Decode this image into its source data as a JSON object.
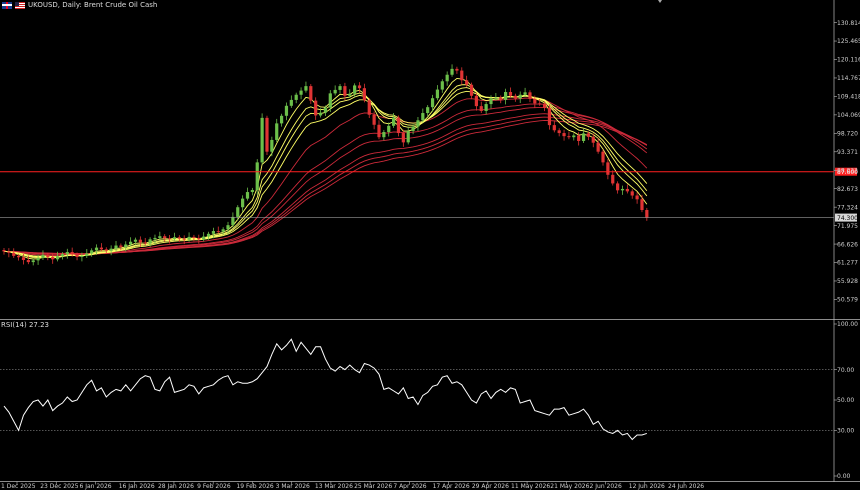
{
  "header": {
    "symbol_title": "UKOUSD, Daily:  Brent Crude Oil Cash",
    "flag_icons": [
      "uk-flag-icon",
      "us-flag-icon"
    ]
  },
  "rsi_panel": {
    "label": "RSI(14) 27.23"
  },
  "colors": {
    "background": "#000000",
    "bull": "#6cbf4a",
    "bear": "#e03434",
    "hline": "#ff2020",
    "current_price_line": "#9a9a9a",
    "rsi_line": "#ffffff",
    "fast_ma": "#ffff66",
    "slow_ma": "#cc2a3a"
  },
  "chart_data": [
    {
      "type": "candlestick",
      "ylim": [
        45.2,
        136.2
      ],
      "y_ticks": [
        "130.814",
        "125.465",
        "120.116",
        "114.767",
        "109.418",
        "104.069",
        "98.720",
        "93.371",
        "88.022",
        "82.673",
        "77.324",
        "71.975",
        "66.626",
        "61.277",
        "55.928",
        "50.579"
      ],
      "x_ticks": [
        "1 Dec 2025",
        "23 Dec 2025",
        "6 Jan 2026",
        "16 Jan 2026",
        "28 Jan 2026",
        "9 Feb 2026",
        "19 Feb 2026",
        "3 Mar 2026",
        "13 Mar 2026",
        "25 Mar 2026",
        "7 Apr 2026",
        "17 Apr 2026",
        "29 Apr 2026",
        "11 May 2026",
        "21 May 2026",
        "2 Jun 2026",
        "12 Jun 2026",
        "24 Jun 2026"
      ],
      "horizontal_line": {
        "value": 87.6,
        "label": "87.600"
      },
      "current_price": {
        "value": 74.3,
        "label": "74.300"
      },
      "close": [
        64.5,
        64.1,
        63.2,
        62.8,
        62.0,
        61.4,
        61.9,
        62.6,
        63.5,
        62.9,
        62.2,
        63.1,
        63.7,
        64.3,
        63.6,
        62.9,
        63.2,
        63.9,
        64.8,
        65.6,
        65.1,
        64.7,
        65.3,
        66.2,
        65.8,
        66.5,
        67.3,
        67.9,
        67.1,
        66.8,
        68.0,
        68.4,
        68.9,
        68.3,
        68.1,
        68.6,
        68.2,
        67.9,
        68.7,
        68.4,
        68.0,
        68.8,
        69.6,
        70.4,
        70.2,
        70.9,
        72.1,
        74.5,
        77.3,
        79.8,
        81.7,
        82.3,
        90.3,
        103.2,
        93.4,
        96.8,
        101.6,
        103.8,
        106.7,
        108.4,
        109.9,
        111.1,
        112.4,
        108.2,
        103.9,
        104.7,
        106.2,
        110.3,
        111.3,
        112.4,
        109.6,
        110.2,
        112.6,
        111.8,
        108.3,
        104.1,
        101.2,
        97.6,
        99.1,
        100.9,
        103.3,
        98.8,
        96.1,
        99.4,
        100.7,
        102.5,
        104.6,
        106.3,
        108.9,
        111.4,
        113.8,
        115.7,
        117.4,
        116.9,
        114.1,
        112.8,
        109.6,
        106.6,
        105.2,
        107.2,
        108.8,
        109.1,
        108.4,
        110.7,
        109.6,
        108.8,
        109.9,
        110.6,
        108.7,
        107.4,
        107.3,
        106.1,
        101.1,
        99.6,
        98.8,
        97.9,
        97.6,
        98.1,
        96.5,
        98.7,
        97.7,
        96.0,
        93.4,
        90.3,
        86.7,
        84.2,
        82.2,
        82.6,
        81.9,
        80.7,
        79.6,
        76.5,
        74.3
      ],
      "fast_moving_averages": [
        "5",
        "8",
        "10",
        "13"
      ],
      "slow_moving_averages": [
        "21",
        "34",
        "40",
        "50",
        "55",
        "60"
      ]
    },
    {
      "type": "line",
      "name": "RSI(14)",
      "ylim": [
        0,
        100
      ],
      "y_ticks": [
        "100.00",
        "70.00",
        "50.00",
        "30.00",
        "0.00"
      ],
      "levels": [
        70,
        30
      ],
      "values": [
        46,
        42,
        36,
        30,
        40,
        45,
        49,
        50,
        46,
        50,
        43,
        46,
        48,
        52,
        49,
        50,
        55,
        60,
        63,
        56,
        58,
        52,
        55,
        57,
        56,
        60,
        56,
        60,
        64,
        66,
        65,
        57,
        56,
        62,
        65,
        55,
        56,
        57,
        60,
        59,
        54,
        58,
        59,
        60,
        63,
        65,
        66,
        60,
        62,
        61,
        61,
        62,
        64,
        68,
        72,
        80,
        87,
        83,
        86,
        90,
        82,
        88,
        84,
        80,
        85,
        85,
        77,
        71,
        69,
        72,
        70,
        73,
        70,
        68,
        74,
        73,
        71,
        67,
        57,
        58,
        56,
        54,
        58,
        51,
        52,
        47,
        53,
        55,
        59,
        60,
        65,
        66,
        61,
        62,
        60,
        55,
        50,
        48,
        54,
        56,
        51,
        55,
        57,
        55,
        58,
        57,
        48,
        49,
        50,
        43,
        42,
        41,
        40,
        44,
        44,
        45,
        40,
        41,
        42,
        44,
        40,
        34,
        36,
        31,
        29,
        28,
        30,
        27,
        28,
        24,
        27,
        27,
        28
      ]
    }
  ]
}
